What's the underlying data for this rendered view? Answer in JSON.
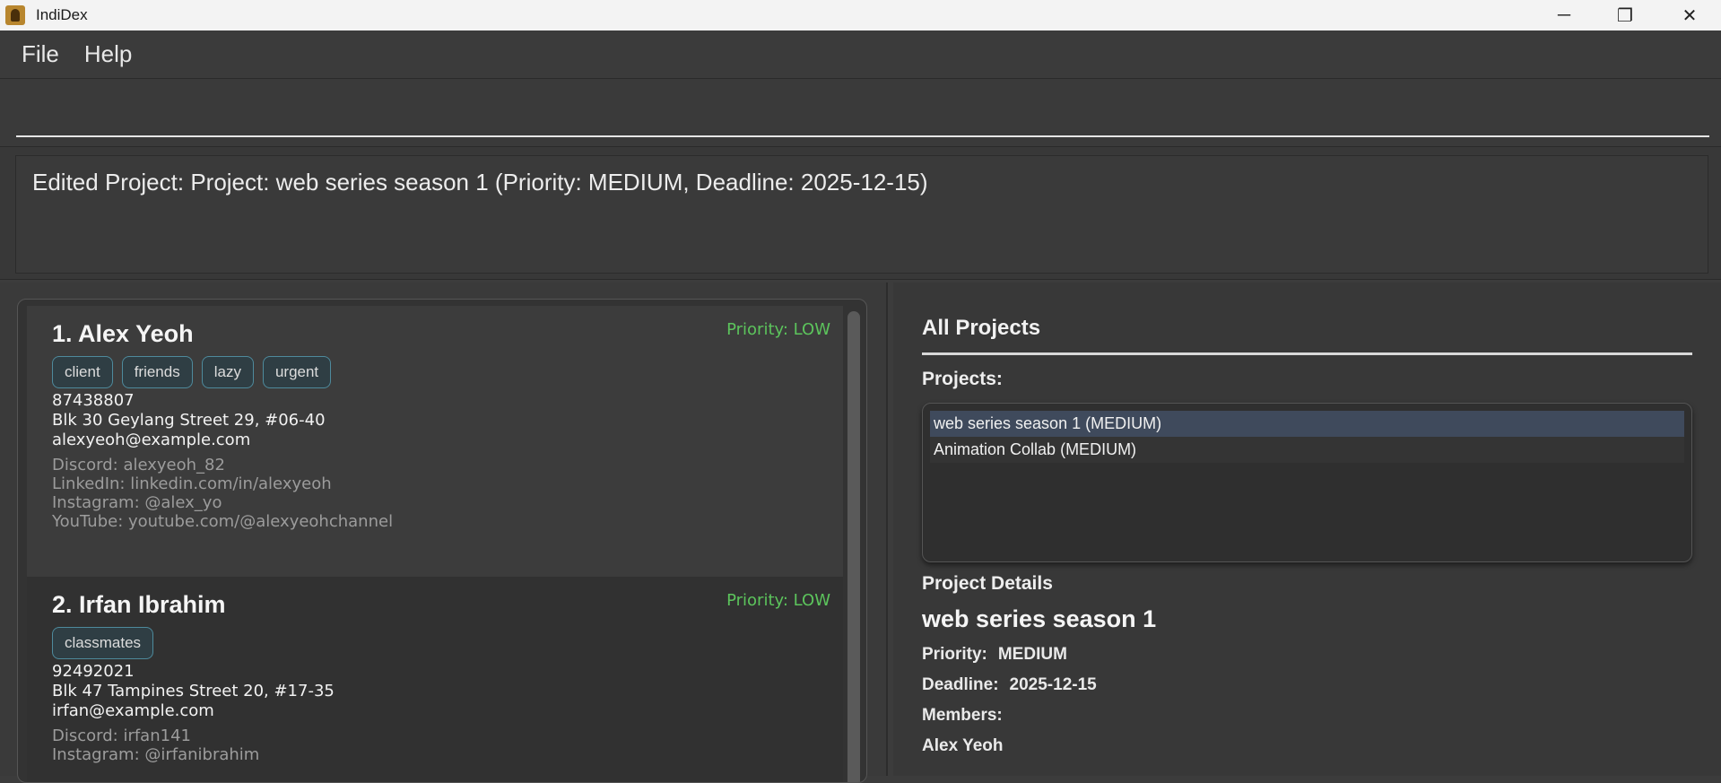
{
  "window": {
    "title": "IndiDex",
    "minimize_glyph": "─",
    "maximize_glyph": "❐",
    "close_glyph": "✕"
  },
  "menu": {
    "items": [
      "File",
      "Help"
    ]
  },
  "command": {
    "value": ""
  },
  "result": {
    "message": "Edited Project: Project: web series season 1 (Priority: MEDIUM, Deadline: 2025-12-15)"
  },
  "persons": [
    {
      "name": "1. Alex Yeoh",
      "priority": "Priority: LOW",
      "tags": [
        "client",
        "friends",
        "lazy",
        "urgent"
      ],
      "phone": "87438807",
      "address": "Blk 30 Geylang Street 29, #06-40",
      "email": "alexyeoh@example.com",
      "socials": [
        "Discord: alexyeoh_82",
        "LinkedIn: linkedin.com/in/alexyeoh",
        "Instagram: @alex_yo",
        "YouTube: youtube.com/@alexyeohchannel"
      ]
    },
    {
      "name": "2. Irfan Ibrahim",
      "priority": "Priority: LOW",
      "tags": [
        "classmates"
      ],
      "phone": "92492021",
      "address": "Blk 47 Tampines Street 20, #17-35",
      "email": "irfan@example.com",
      "socials": [
        "Discord: irfan141",
        "Instagram: @irfanibrahim"
      ]
    }
  ],
  "projects_panel": {
    "title": "All Projects",
    "list_label": "Projects:",
    "projects": [
      "web series season 1 (MEDIUM)",
      "Animation Collab (MEDIUM)"
    ],
    "details_label": "Project Details",
    "selected_name": "web series season 1",
    "priority_label": "Priority:",
    "priority_value": "MEDIUM",
    "deadline_label": "Deadline:",
    "deadline_value": "2025-12-15",
    "members_label": "Members:",
    "members": [
      "Alex Yeoh"
    ]
  },
  "colors": {
    "priority_low": "#5cc45c",
    "tag_border": "#4e8a9c",
    "selected_row": "#3f4a5c"
  }
}
